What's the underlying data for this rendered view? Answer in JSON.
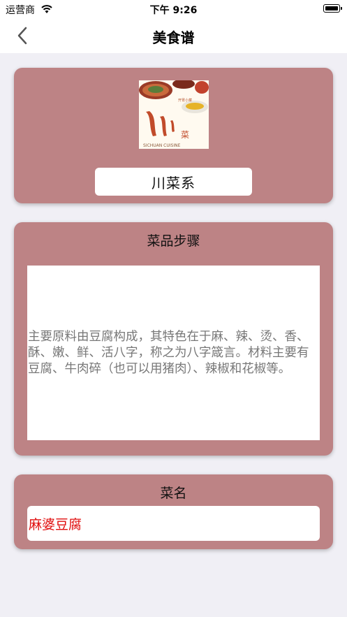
{
  "status_bar": {
    "carrier": "运营商",
    "time": "下午 9:26"
  },
  "nav": {
    "title": "美食谱"
  },
  "cuisine": {
    "image_caption": "川 菜",
    "image_subtext": "SICHUAN CUISINE",
    "name": "川菜系"
  },
  "steps": {
    "heading": "菜品步骤",
    "text": "主要原料由豆腐构成，其特色在于麻、辣、烫、香、酥、嫩、鲜、活八字，称之为八字箴言。材料主要有豆腐、牛肉碎（也可以用猪肉）、辣椒和花椒等。"
  },
  "dish": {
    "heading": "菜名",
    "name": "麻婆豆腐"
  },
  "colors": {
    "card_bg": "#bd8385",
    "dish_name": "#e00d0d"
  }
}
